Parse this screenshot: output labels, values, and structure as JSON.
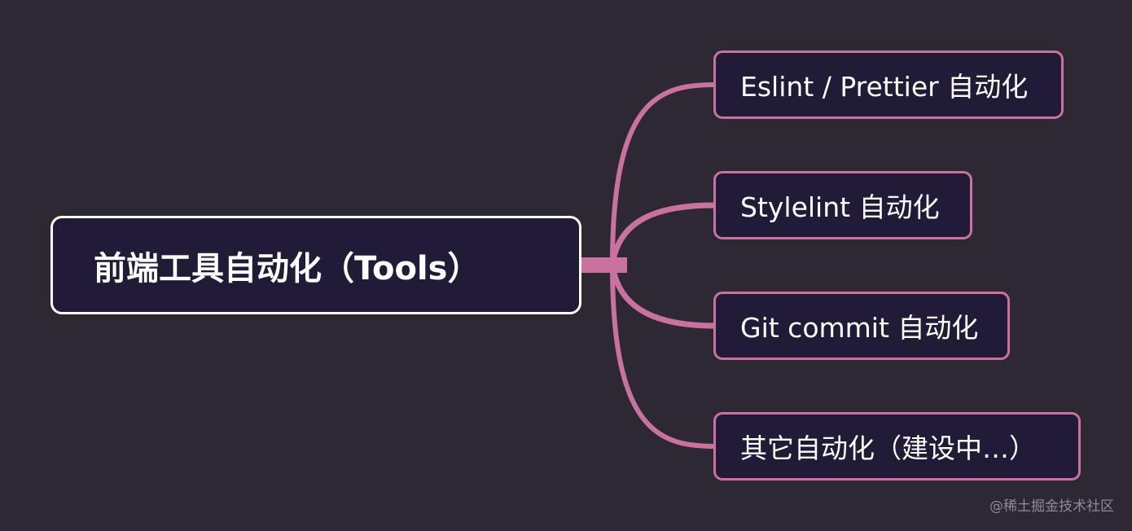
{
  "mindmap": {
    "root": {
      "label": "前端工具自动化（Tools）"
    },
    "children": [
      {
        "label": "Eslint / Prettier 自动化"
      },
      {
        "label": "Stylelint 自动化"
      },
      {
        "label": "Git commit 自动化"
      },
      {
        "label": "其它自动化（建设中…）"
      }
    ],
    "colors": {
      "background": "#2e2832",
      "node_fill": "#211b38",
      "root_border": "#ffffff",
      "branch": "#c9719f",
      "text": "#ffffff"
    }
  },
  "credit": "@稀土掘金技术社区"
}
